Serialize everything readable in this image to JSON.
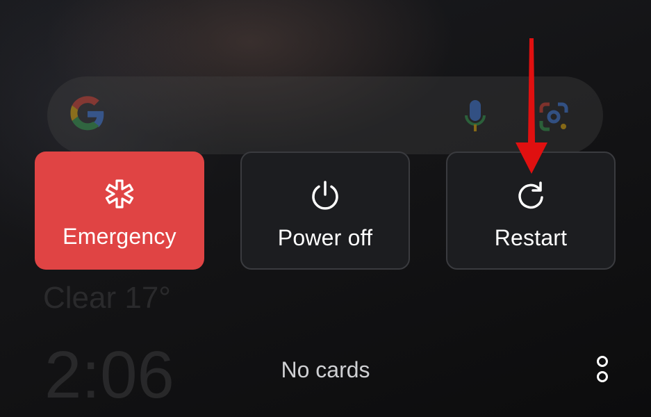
{
  "lockscreen": {
    "date": "",
    "weather": "Clear 17°",
    "clock": "2:06"
  },
  "search_bar": {
    "logo_icon": "google-logo-icon",
    "mic_icon": "microphone-icon",
    "lens_icon": "google-lens-icon"
  },
  "power_menu": {
    "emergency": {
      "label": "Emergency",
      "icon": "medical-star-icon",
      "color": "#e04444"
    },
    "power_off": {
      "label": "Power off",
      "icon": "power-icon"
    },
    "restart": {
      "label": "Restart",
      "icon": "restart-icon"
    }
  },
  "wallet": {
    "empty_text": "No cards"
  },
  "more_icon": "more-vertical-icon",
  "annotation": {
    "arrow_color": "#e01010",
    "arrow_target": "Restart"
  }
}
